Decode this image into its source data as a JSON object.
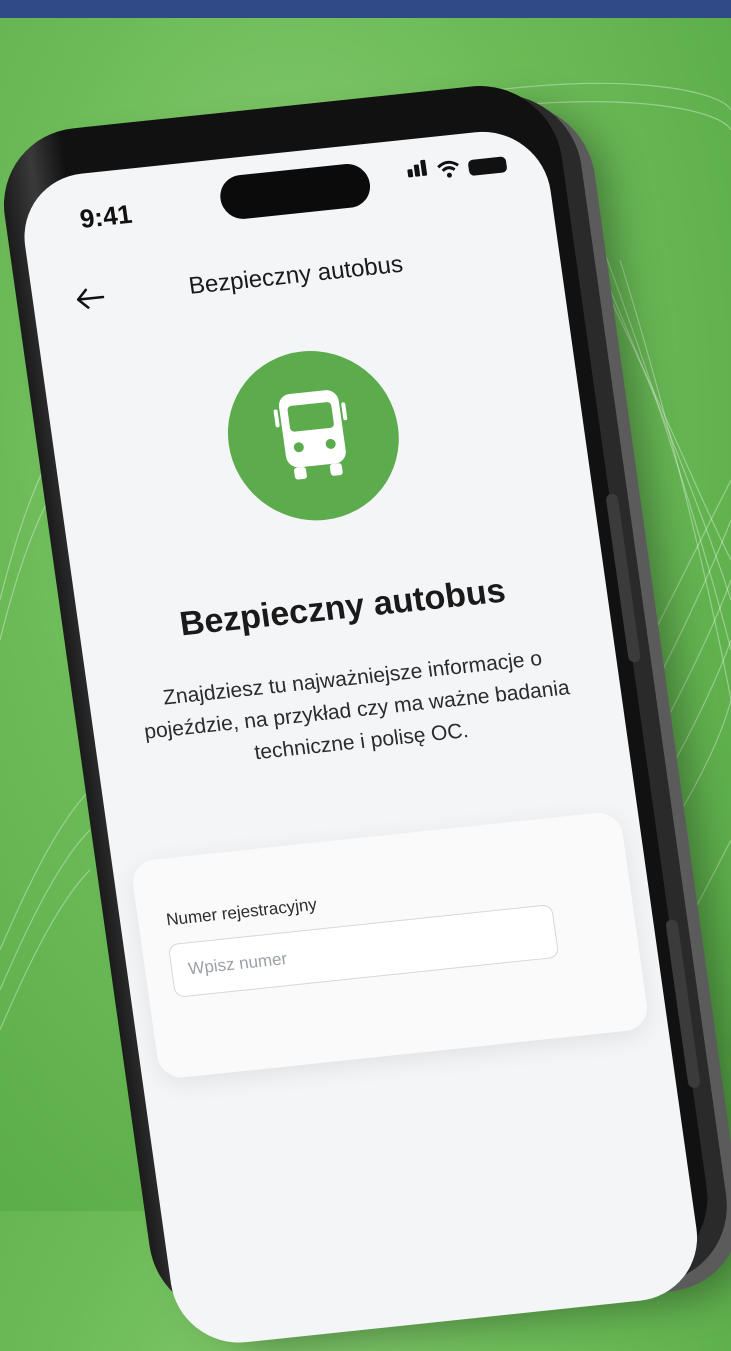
{
  "status_bar": {
    "time": "9:41"
  },
  "nav": {
    "title": "Bezpieczny autobus"
  },
  "hero": {
    "headline": "Bezpieczny autobus",
    "description": "Znajdziesz tu najważniejsze informacje o pojeździe, na przykład czy ma ważne badania techniczne i polisę OC."
  },
  "form": {
    "label": "Numer rejestracyjny",
    "placeholder": "Wpisz numer",
    "value": ""
  },
  "colors": {
    "background": "#6cbb58",
    "accent": "#5cab4c",
    "topbar": "#2f4a86"
  },
  "icons": [
    "back-arrow-icon",
    "bus-icon",
    "signal-icon",
    "wifi-icon",
    "battery-icon"
  ]
}
